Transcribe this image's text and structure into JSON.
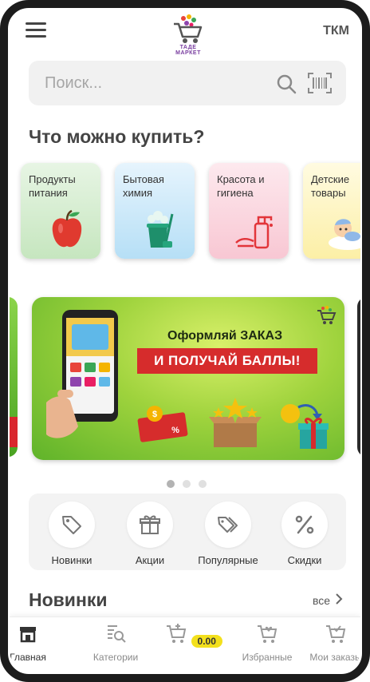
{
  "header": {
    "logo_text": "ТАДЕ МАРКЕТ",
    "region": "ТКМ"
  },
  "search": {
    "placeholder": "Поиск..."
  },
  "categories_section": {
    "title": "Что можно купить?",
    "items": [
      {
        "label": "Продукты питания",
        "icon": "apple-icon"
      },
      {
        "label": "Бытовая химия",
        "icon": "cleaning-bucket-icon"
      },
      {
        "label": "Красота и гигиена",
        "icon": "soap-dispenser-icon"
      },
      {
        "label": "Детские товары",
        "icon": "baby-icon"
      }
    ]
  },
  "banner": {
    "title": "Оформляй ЗАКАЗ",
    "cta": "И ПОЛУЧАЙ БАЛЛЫ!",
    "slides_count": 3,
    "active_slide": 1
  },
  "quick_links": [
    {
      "label": "Новинки",
      "icon": "tag-icon"
    },
    {
      "label": "Акции",
      "icon": "gift-icon"
    },
    {
      "label": "Популярные",
      "icon": "tags-icon"
    },
    {
      "label": "Скидки",
      "icon": "percent-icon"
    }
  ],
  "new_items": {
    "title": "Новинки",
    "all_label": "все"
  },
  "bottom_nav": {
    "items": [
      {
        "label": "Главная",
        "icon": "store-icon",
        "active": true
      },
      {
        "label": "Категории",
        "icon": "catalog-search-icon",
        "active": false
      },
      {
        "label": "0.00",
        "icon": "cart-add-icon",
        "active": false
      },
      {
        "label": "Избранные",
        "icon": "cart-heart-icon",
        "active": false
      },
      {
        "label": "Мои заказы",
        "icon": "cart-check-icon",
        "active": false
      }
    ]
  },
  "colors": {
    "accent_yellow": "#f3e01c",
    "banner_red": "#d62c2c",
    "banner_green": "#7cc33a"
  }
}
